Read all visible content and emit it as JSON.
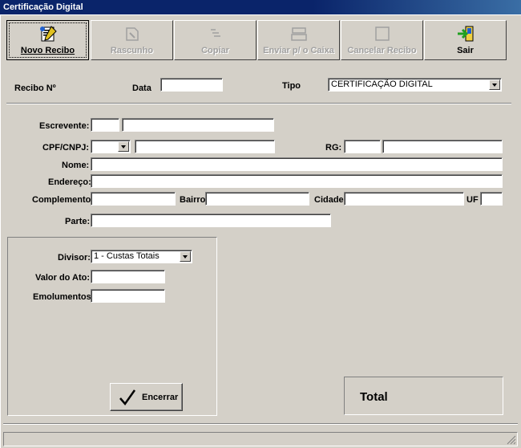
{
  "window": {
    "title": "Certificação Digital"
  },
  "toolbar": {
    "novo_recibo": "Novo Recibo",
    "rascunho": "Rascunho",
    "copiar": "Copiar",
    "enviar_caixa": "Enviar p/ o Caixa",
    "cancelar_recibo": "Cancelar Recibo",
    "sair": "Sair"
  },
  "header": {
    "recibo_label": "Recibo Nº",
    "recibo_value": "",
    "data_label": "Data",
    "data_value": "",
    "tipo_label": "Tipo",
    "tipo_value": "CERTIFICAÇÃO DIGITAL"
  },
  "form": {
    "escrevente_label": "Escrevente:",
    "cpf_label": "CPF/CNPJ:",
    "rg_label": "RG:",
    "nome_label": "Nome:",
    "endereco_label": "Endereço:",
    "complemento_label": "Complemento:",
    "bairro_label": "Bairro",
    "cidade_label": "Cidade",
    "uf_label": "UF",
    "parte_label": "Parte:"
  },
  "valores": {
    "divisor_label": "Divisor:",
    "divisor_value": "1 - Custas Totais",
    "valor_ato_label": "Valor do Ato:",
    "emolumentos_label": "Emolumentos:",
    "encerrar_label": "Encerrar"
  },
  "total": {
    "label": "Total"
  },
  "colors": {
    "title_bar": "#0a246a",
    "face": "#d4d0c8"
  }
}
